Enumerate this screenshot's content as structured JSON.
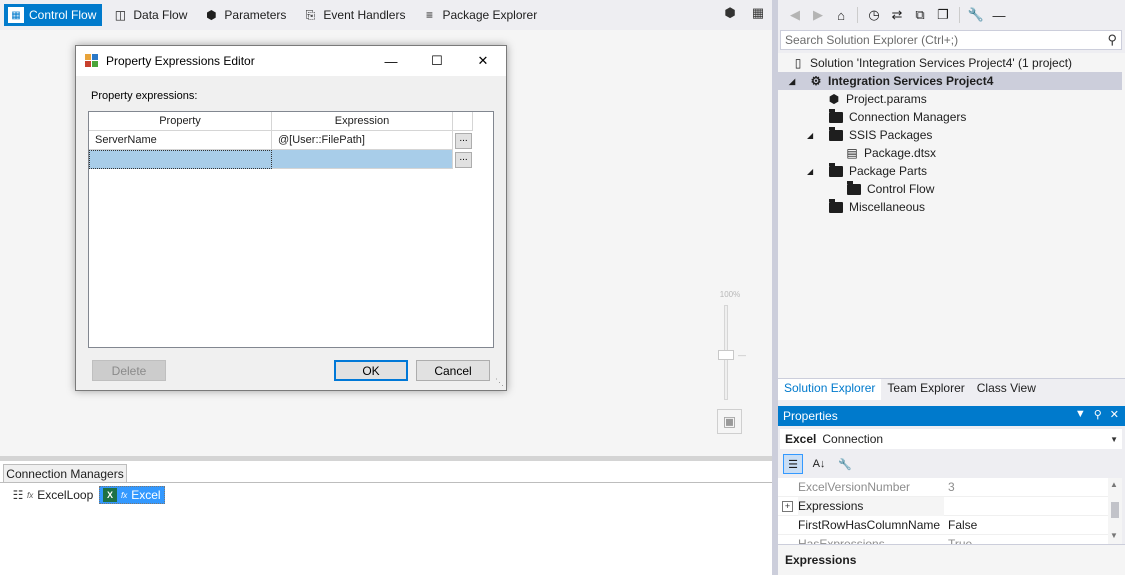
{
  "designer": {
    "tabs": [
      {
        "label": "Control Flow",
        "icon": "control-flow-icon",
        "active": true
      },
      {
        "label": "Data Flow",
        "icon": "data-flow-icon",
        "active": false
      },
      {
        "label": "Parameters",
        "icon": "parameters-icon",
        "active": false
      },
      {
        "label": "Event Handlers",
        "icon": "event-handlers-icon",
        "active": false
      },
      {
        "label": "Package Explorer",
        "icon": "package-explorer-icon",
        "active": false
      }
    ],
    "zoom_label": "100%"
  },
  "dialog": {
    "title": "Property Expressions Editor",
    "label": "Property expressions:",
    "columns": [
      "Property",
      "Expression"
    ],
    "rows": [
      {
        "property": "ServerName",
        "expression": "@[User::FilePath]",
        "button": "..."
      },
      {
        "property": "",
        "expression": "",
        "button": "..."
      }
    ],
    "buttons": {
      "delete": "Delete",
      "ok": "OK",
      "cancel": "Cancel"
    }
  },
  "connection_managers": {
    "tab_label": "Connection Managers",
    "items": [
      {
        "name": "ExcelLoop",
        "prefix": "fx",
        "selected": false
      },
      {
        "name": "Excel",
        "prefix": "fx",
        "selected": true
      }
    ]
  },
  "solution_explorer": {
    "search_placeholder": "Search Solution Explorer (Ctrl+;)",
    "tree": [
      {
        "label": "Solution 'Integration Services Project4' (1 project)",
        "icon": "solution-icon"
      },
      {
        "label": "Integration Services Project4",
        "icon": "ssis-project-icon",
        "selected": true
      },
      {
        "label": "Project.params",
        "icon": "params-icon"
      },
      {
        "label": "Connection Managers",
        "icon": "folder-icon"
      },
      {
        "label": "SSIS Packages",
        "icon": "folder-icon"
      },
      {
        "label": "Package.dtsx",
        "icon": "package-icon"
      },
      {
        "label": "Package Parts",
        "icon": "folder-icon"
      },
      {
        "label": "Control Flow",
        "icon": "folder-icon"
      },
      {
        "label": "Miscellaneous",
        "icon": "folder-icon"
      }
    ],
    "tabs": [
      "Solution Explorer",
      "Team Explorer",
      "Class View"
    ],
    "active_tab": "Solution Explorer"
  },
  "properties": {
    "title": "Properties",
    "object_name": "Excel",
    "object_type": "Connection",
    "rows": [
      {
        "name": "ExcelVersionNumber",
        "value": "3"
      },
      {
        "name": "Expressions",
        "value": ""
      },
      {
        "name": "FirstRowHasColumnName",
        "value": "False"
      },
      {
        "name": "HasExpressions",
        "value": "True"
      }
    ],
    "description_title": "Expressions"
  },
  "colors": {
    "accent": "#007acc",
    "selection": "#3399ff",
    "grid_selection": "#a8cde9"
  }
}
